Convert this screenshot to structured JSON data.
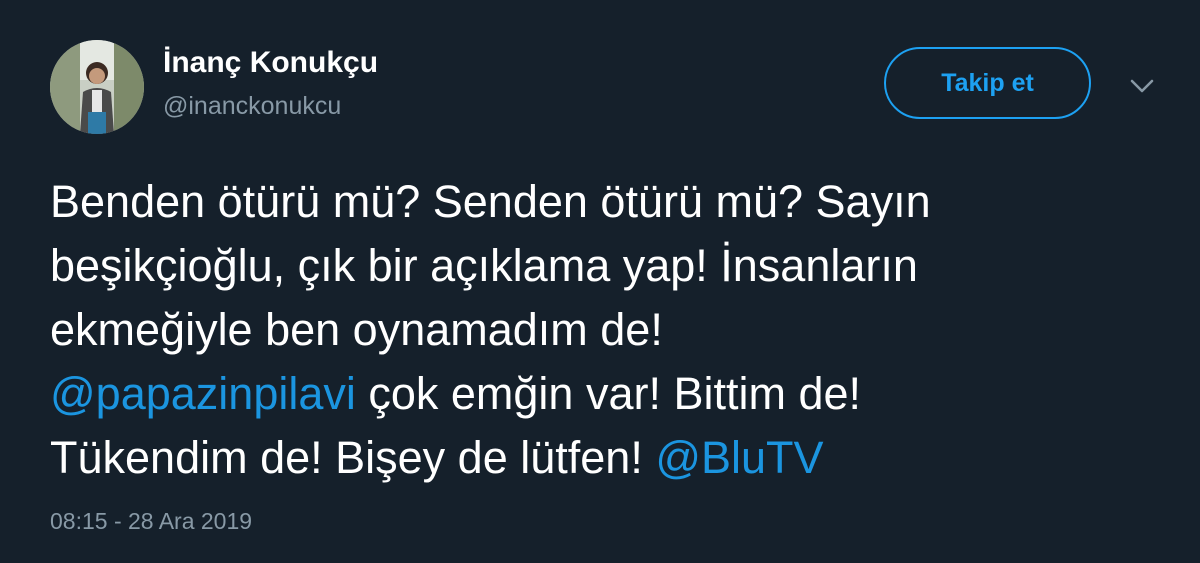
{
  "author": {
    "display_name": "İnanç Konukçu",
    "handle": "@inanckonukcu"
  },
  "actions": {
    "follow_label": "Takip et",
    "more_icon": "chevron-down-icon"
  },
  "tweet": {
    "line1": "Benden ötürü mü? Senden ötürü mü? Sayın",
    "line2": "beşikçioğlu, çık bir açıklama yap! İnsanların",
    "line3": "ekmeğiyle ben oynamadım de!",
    "mention1": "@papazinpilavi",
    "line4_rest": " çok emğin var! Bittim de!",
    "line5": "Tükendim de! Bişey de lütfen! ",
    "mention2": "@BluTV"
  },
  "timestamp": "08:15 - 28 Ara 2019",
  "colors": {
    "background": "#15202b",
    "accent": "#1da1f2",
    "mention": "#1b95e0",
    "secondary_text": "#8899a6"
  }
}
